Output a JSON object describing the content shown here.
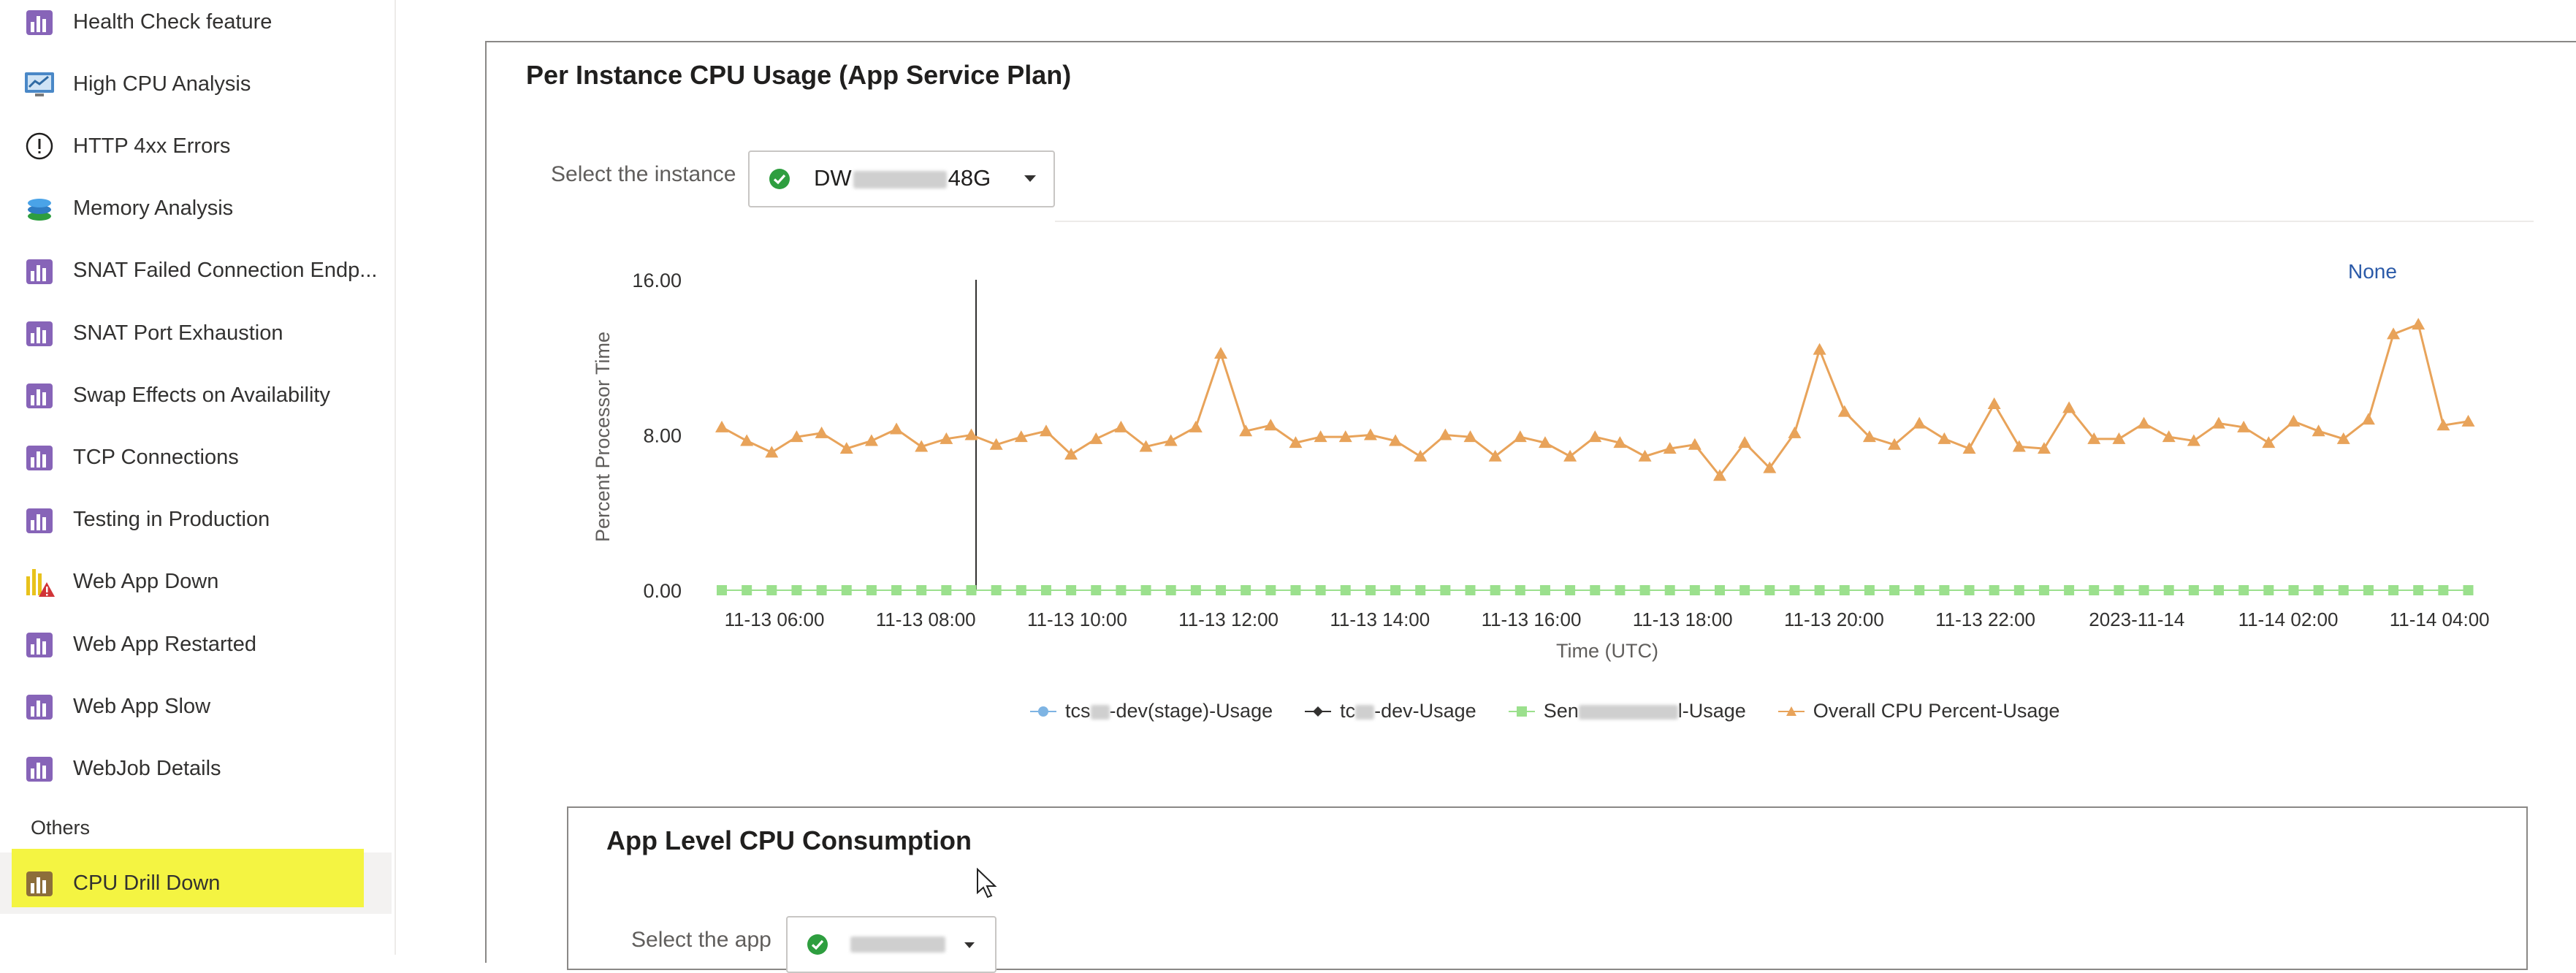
{
  "sidebar": {
    "items": [
      {
        "label": "Health Check feature",
        "icon": "bar-chart-icon"
      },
      {
        "label": "High CPU Analysis",
        "icon": "monitor-chart-icon"
      },
      {
        "label": "HTTP 4xx Errors",
        "icon": "exclamation-circle-icon"
      },
      {
        "label": "Memory Analysis",
        "icon": "memory-stack-icon"
      },
      {
        "label": "SNAT Failed Connection Endp...",
        "icon": "bar-chart-icon"
      },
      {
        "label": "SNAT Port Exhaustion",
        "icon": "bar-chart-icon"
      },
      {
        "label": "Swap Effects on Availability",
        "icon": "bar-chart-icon"
      },
      {
        "label": "TCP Connections",
        "icon": "bar-chart-icon"
      },
      {
        "label": "Testing in Production",
        "icon": "bar-chart-icon"
      },
      {
        "label": "Web App Down",
        "icon": "bar-chart-warning-icon"
      },
      {
        "label": "Web App Restarted",
        "icon": "bar-chart-icon"
      },
      {
        "label": "Web App Slow",
        "icon": "bar-chart-icon"
      },
      {
        "label": "WebJob Details",
        "icon": "bar-chart-icon"
      }
    ],
    "section_label": "Others",
    "active_item": {
      "label": "CPU Drill Down",
      "icon": "bar-chart-icon"
    },
    "colors": {
      "icon_purple": "#8764b8",
      "highlight": "#f4f442"
    }
  },
  "main": {
    "panel_title": "Per Instance CPU Usage (App Service Plan)",
    "instance_select": {
      "label": "Select the instance",
      "value_prefix": "DW",
      "value_suffix": "48G"
    },
    "none_link": "None",
    "chart_data": {
      "type": "line",
      "ylabel": "Percent Processor Time",
      "xlabel": "Time (UTC)",
      "ylim": [
        0,
        16
      ],
      "yticks": [
        "0.00",
        "8.00",
        "16.00"
      ],
      "xticks": [
        "11-13 06:00",
        "11-13 08:00",
        "11-13 10:00",
        "11-13 12:00",
        "11-13 14:00",
        "11-13 16:00",
        "11-13 18:00",
        "11-13 20:00",
        "11-13 22:00",
        "2023-11-14",
        "11-14 02:00",
        "11-14 04:00"
      ],
      "x_start": "11-13 05:40",
      "x_step_minutes": 20,
      "series": [
        {
          "name": "tcs-dev(stage)-Usage",
          "color": "#7eb4e3",
          "marker": "circle",
          "values": []
        },
        {
          "name": "tc-dev-Usage",
          "color": "#323130",
          "marker": "diamond",
          "values": []
        },
        {
          "name": "Sen-I-Usage",
          "color": "#9be08d",
          "marker": "square",
          "constant": 0,
          "count": 71
        },
        {
          "name": "Overall CPU Percent-Usage",
          "color": "#e8a35a",
          "marker": "triangle",
          "values": [
            8.4,
            7.7,
            7.1,
            7.9,
            8.1,
            7.3,
            7.7,
            8.3,
            7.4,
            7.8,
            8.0,
            7.5,
            7.9,
            8.2,
            7.0,
            7.8,
            8.4,
            7.4,
            7.7,
            8.4,
            12.2,
            8.2,
            8.5,
            7.6,
            7.9,
            7.9,
            8.0,
            7.7,
            6.9,
            8.0,
            7.9,
            6.9,
            7.9,
            7.6,
            6.9,
            7.9,
            7.6,
            6.9,
            7.3,
            7.5,
            5.9,
            7.6,
            6.3,
            8.1,
            12.4,
            9.2,
            7.9,
            7.5,
            8.6,
            7.8,
            7.3,
            9.6,
            7.4,
            7.3,
            9.4,
            7.8,
            7.8,
            8.6,
            7.9,
            7.7,
            8.6,
            8.4,
            7.6,
            8.7,
            8.2,
            7.8,
            8.8,
            13.2,
            13.7,
            8.5,
            8.7
          ]
        }
      ],
      "legend": "bottom-center",
      "grid": false
    },
    "legend": {
      "s1_a": "tcs",
      "s1_b": "-dev(stage)-Usage",
      "s2_a": "tc",
      "s2_b": "-dev-Usage",
      "s3_a": "Sen",
      "s3_b": "l-Usage",
      "s4": "Overall CPU Percent-Usage"
    },
    "panel2": {
      "title": "App Level CPU Consumption",
      "app_select_label": "Select the app"
    }
  }
}
